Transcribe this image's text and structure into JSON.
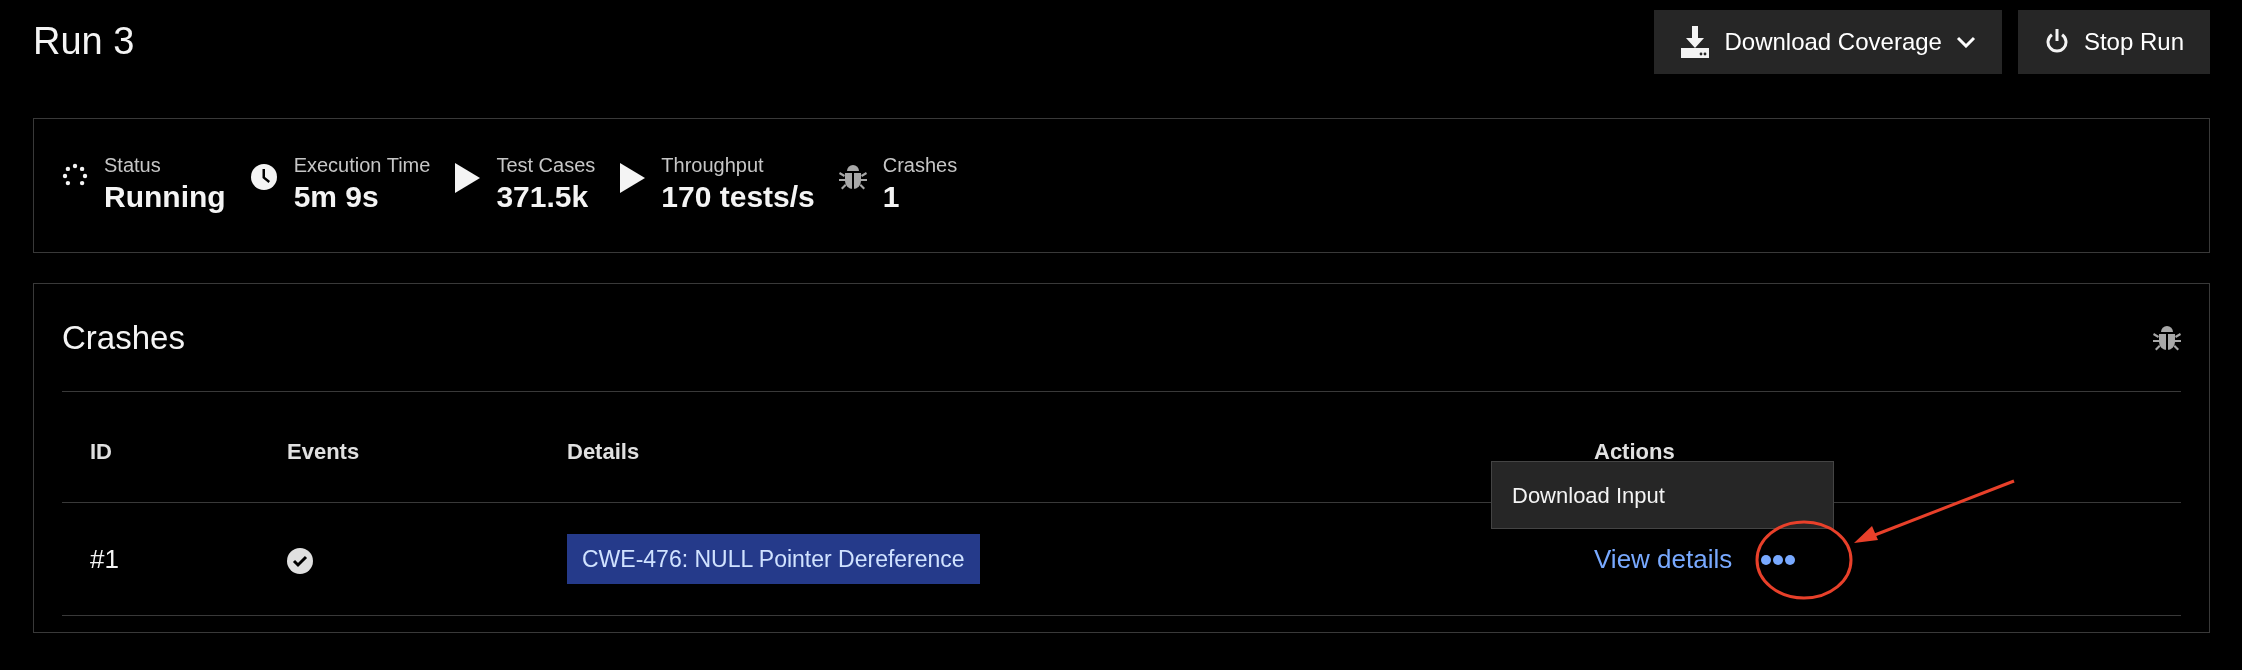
{
  "page": {
    "title": "Run 3"
  },
  "header_buttons": [
    {
      "label": "Download Coverage",
      "kind": "download",
      "dropdown": true
    },
    {
      "label": "Stop Run",
      "kind": "power",
      "dropdown": false
    }
  ],
  "stats": [
    {
      "kind": "spinner",
      "label": "Status",
      "value": "Running"
    },
    {
      "kind": "clock",
      "label": "Execution Time",
      "value": "5m 9s"
    },
    {
      "kind": "play",
      "label": "Test Cases",
      "value": "371.5k"
    },
    {
      "kind": "play",
      "label": "Throughput",
      "value": "170 tests/s"
    },
    {
      "kind": "bug",
      "label": "Crashes",
      "value": "1"
    }
  ],
  "crashes": {
    "title": "Crashes",
    "table": {
      "columns": [
        "ID",
        "Events",
        "Details",
        "Actions"
      ],
      "rows": [
        {
          "id": "#1",
          "events_ok": true,
          "detail_tag": "CWE-476: NULL Pointer Dereference",
          "action_link": "View details",
          "menu_open": true,
          "menu_items": [
            "Download Input"
          ],
          "highlighted": true
        }
      ]
    }
  }
}
